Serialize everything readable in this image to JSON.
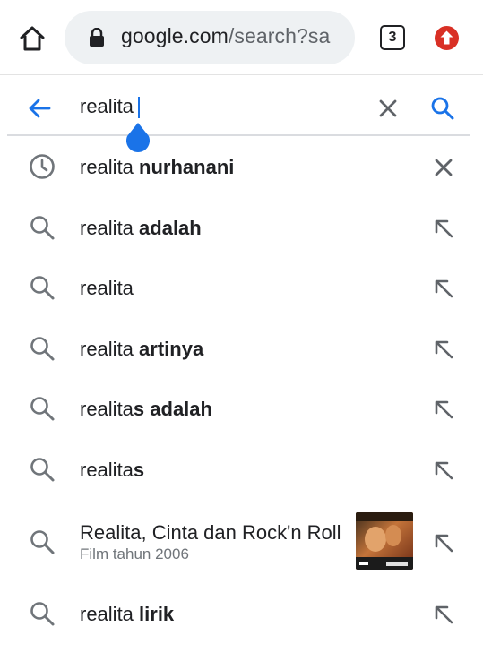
{
  "browser": {
    "url_domain": "google.com",
    "url_path": "/search?sa",
    "tab_count": "3",
    "icons": [
      "home-icon",
      "lock-icon",
      "tab-switcher-icon",
      "update-icon"
    ]
  },
  "search": {
    "query": "realita",
    "icons": [
      "back-arrow-icon",
      "clear-icon",
      "search-icon"
    ],
    "accent_color": "#1a73e8"
  },
  "suggestions": [
    {
      "prefix": "realita",
      "bold": " nurhanani",
      "type": "history",
      "action": "remove"
    },
    {
      "prefix": "realita",
      "bold": " adalah",
      "type": "search",
      "action": "fill"
    },
    {
      "prefix": "realita",
      "bold": "",
      "type": "search",
      "action": "fill"
    },
    {
      "prefix": "realita",
      "bold": " artinya",
      "type": "search",
      "action": "fill"
    },
    {
      "prefix": "realita",
      "bold": "s adalah",
      "type": "search",
      "action": "fill"
    },
    {
      "prefix": "realita",
      "bold": "s",
      "type": "search",
      "action": "fill"
    },
    {
      "prefix": "Realita, Cinta dan Rock'n Roll",
      "bold": "",
      "subtitle": "Film tahun 2006",
      "type": "entity",
      "action": "fill"
    },
    {
      "prefix": "realita",
      "bold": " lirik",
      "type": "search",
      "action": "fill"
    }
  ]
}
